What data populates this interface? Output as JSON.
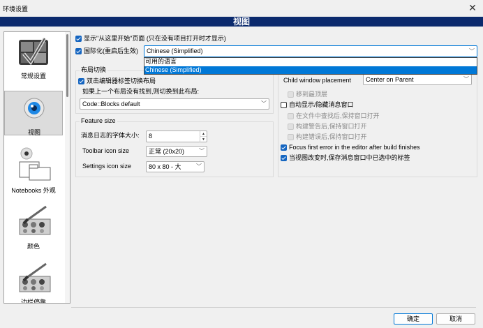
{
  "window": {
    "title": "环境设置",
    "close_glyph": "✕"
  },
  "header": {
    "title": "视图"
  },
  "sidebar": {
    "items": [
      {
        "label": "常规设置",
        "icon": "general-settings-icon"
      },
      {
        "label": "视图",
        "icon": "eye-view-icon",
        "selected": true
      },
      {
        "label": "Notebooks 外观",
        "icon": "notebooks-icon"
      },
      {
        "label": "颜色",
        "icon": "palette-icon"
      },
      {
        "label": "边栏停靠",
        "icon": "dock-palette-icon"
      }
    ]
  },
  "main": {
    "show_start_page": {
      "label": "显示\"从这里开始\"页面 (只在没有项目打开时才显示)",
      "checked": true
    },
    "i18n": {
      "label": "国际化(重启后生效)",
      "checked": true,
      "value": "Chinese (Simplified)",
      "options_header": "可用的语言",
      "options": [
        "Chinese (Simplified)"
      ]
    },
    "layout_switch": {
      "group_label": "布局切换",
      "dblclick_label": "双击编辑器标签切换布局",
      "dblclick_checked": true,
      "fallback_label": "如果上一个布局没有找到,则切换到此布局:",
      "fallback_value": "Code::Blocks default"
    },
    "feature_size": {
      "group_label": "Feature size",
      "msg_font_label": "消息日志的字体大小:",
      "msg_font_value": "8",
      "toolbar_icon_label": "Toolbar icon size",
      "toolbar_icon_value": "正常 (20x20)",
      "settings_icon_label": "Settings icon size",
      "settings_icon_value": "80 x 80 - 大"
    },
    "child_window": {
      "label": "Child window placement",
      "value": "Center on Parent",
      "move_top_label": "移到最顶层",
      "move_top_checked": false
    },
    "auto_show": {
      "label": "自动显示/隐藏消息窗口",
      "checked": false,
      "options": [
        {
          "label": "在文件中查找后,保持窗口打开",
          "checked": true
        },
        {
          "label": "构建警告后,保持窗口打开",
          "checked": true
        },
        {
          "label": "构建错误后,保持窗口打开",
          "checked": true
        }
      ]
    },
    "focus_first_error": {
      "label": "Focus first error in the editor after build finishes",
      "checked": true
    },
    "keep_selected_tab": {
      "label": "当视图改变时,保存消息窗口中已选中的标签",
      "checked": true
    }
  },
  "footer": {
    "ok_label": "确定",
    "cancel_label": "取消"
  },
  "colors": {
    "banner": "#0b2a6d",
    "accent": "#1565c0",
    "selection": "#0078d7"
  }
}
